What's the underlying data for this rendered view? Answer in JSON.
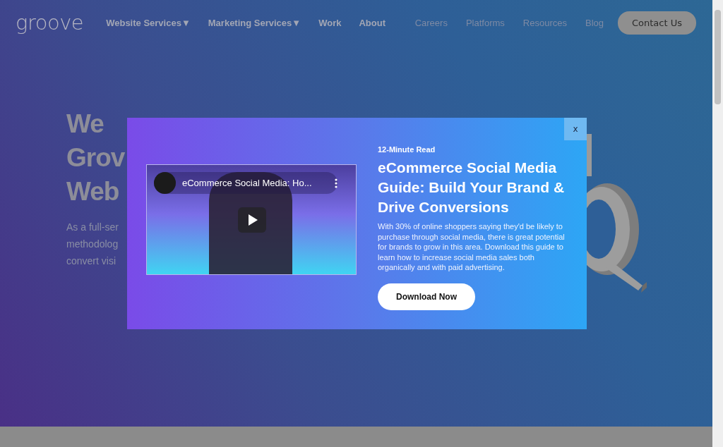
{
  "nav": {
    "logo": "groove",
    "primary": [
      {
        "label": "Website Services",
        "caret": "▼"
      },
      {
        "label": "Marketing Services",
        "caret": "▼"
      },
      {
        "label": "Work"
      },
      {
        "label": "About"
      }
    ],
    "secondary": [
      "Careers",
      "Platforms",
      "Resources",
      "Blog"
    ],
    "cta": "Contact Us"
  },
  "hero": {
    "heading_lines": [
      "We",
      "Grov",
      "Web"
    ],
    "text_lines": [
      "As a full-ser",
      "methodolog",
      "convert visi"
    ]
  },
  "modal": {
    "close": "x",
    "video": {
      "title": "eCommerce Social Media: Ho..."
    },
    "eyebrow": "12-Minute Read",
    "title": "eCommerce Social Media Guide: Build Your Brand & Drive Conversions",
    "body": "With 30% of online shoppers saying they'd be likely to purchase through social media, there is great potential for brands to grow in this area. Download this guide to learn how to increase social media sales both organically and with paid advertising.",
    "button": "Download Now"
  }
}
